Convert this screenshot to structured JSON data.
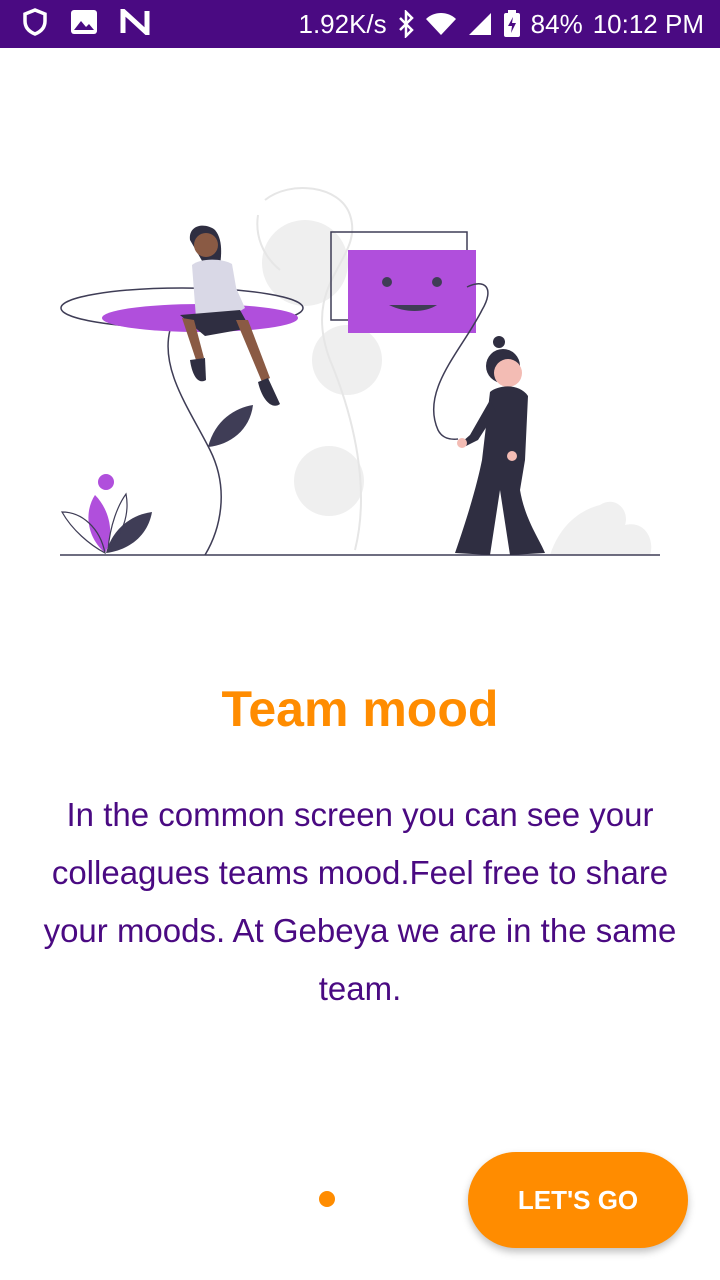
{
  "status_bar": {
    "net_speed": "1.92K/s",
    "battery": "84%",
    "time": "10:12 PM",
    "icons": [
      "shield-icon",
      "image-icon",
      "n-logo-icon",
      "bluetooth-icon",
      "wifi-icon",
      "signal-icon",
      "battery-icon"
    ]
  },
  "onboarding": {
    "title": "Team mood",
    "description": "In the common screen you can see your colleagues teams mood.Feel free to share your moods. At Gebeya we are in the same team.",
    "page_indicator": {
      "current": 1
    },
    "cta_label": "LET'S GO"
  },
  "colors": {
    "status_bar": "#4a0a82",
    "accent": "#ff8c00",
    "text": "#4a0a82",
    "illustration_accent": "#b04fdc"
  }
}
